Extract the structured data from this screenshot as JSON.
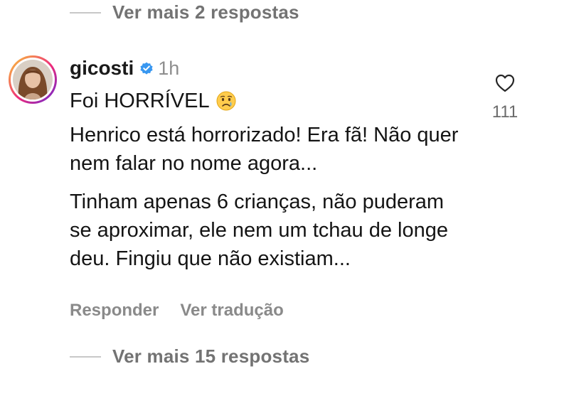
{
  "replies_top": {
    "label": "Ver mais 2 respostas"
  },
  "comment": {
    "username": "gicosti",
    "time": "1h",
    "lines": [
      "Foi HORRÍVEL",
      "Henrico está horrorizado! Era fã! Não quer nem falar no nome agora...",
      "Tinham apenas 6 crianças, não puderam se aproximar, ele nem um tchau de longe deu. Fingiu que não existiam..."
    ],
    "emoji": "crying-face-emoji",
    "like_count": "111"
  },
  "actions": {
    "reply_label": "Responder",
    "translate_label": "Ver tradução"
  },
  "replies_bottom": {
    "label": "Ver mais 15 respostas"
  },
  "colors": {
    "verified": "#3897f0",
    "secondary_text": "#737373",
    "story_ring": "#ee2a7b"
  },
  "icons": [
    "verified-badge-icon",
    "heart-icon"
  ]
}
